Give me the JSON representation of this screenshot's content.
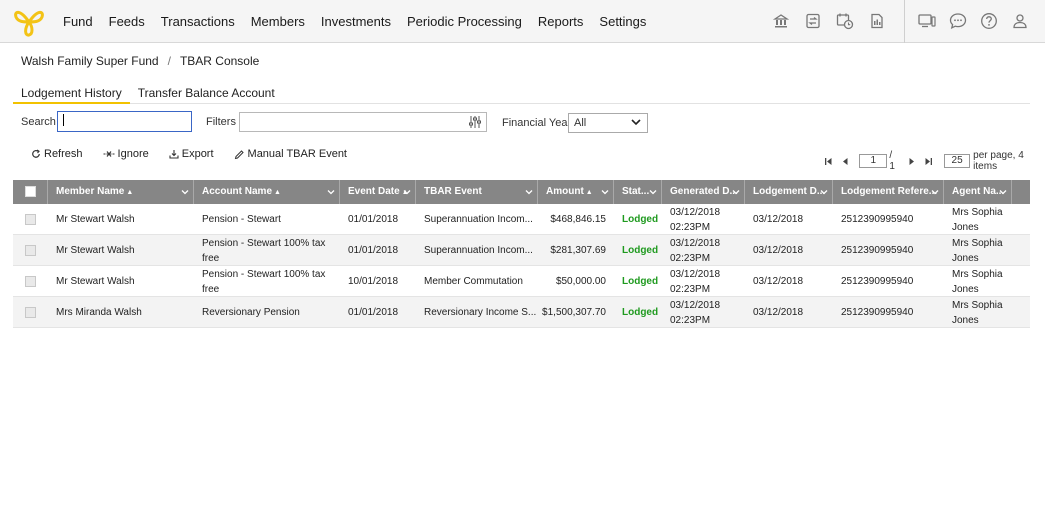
{
  "nav": {
    "items": [
      "Fund",
      "Feeds",
      "Transactions",
      "Members",
      "Investments",
      "Periodic Processing",
      "Reports",
      "Settings"
    ]
  },
  "toolbar_icons": [
    "bank-icon",
    "transfer-icon",
    "calendar-clock-icon",
    "document-icon"
  ],
  "user_icons": [
    "monitor-icon",
    "chat-icon",
    "help-icon",
    "user-icon"
  ],
  "breadcrumb": {
    "fund": "Walsh Family Super Fund",
    "sep": "/",
    "page": "TBAR Console"
  },
  "tabs": [
    {
      "label": "Lodgement History",
      "active": true
    },
    {
      "label": "Transfer Balance Account",
      "active": false
    }
  ],
  "filters": {
    "search_label": "Search",
    "search_value": "",
    "filters_label": "Filters",
    "fy_label": "Financial Year",
    "fy_value": "All"
  },
  "actions": {
    "refresh": "Refresh",
    "ignore": "Ignore",
    "export": "Export",
    "manual": "Manual TBAR Event"
  },
  "pager": {
    "page": "1",
    "total": "/ 1",
    "size": "25",
    "suffix": "per page, 4 items"
  },
  "grid": {
    "columns": [
      "Member Name",
      "Account Name",
      "Event Date",
      "TBAR Event",
      "Amount",
      "Stat...",
      "Generated D...",
      "Lodgement D...",
      "Lodgement Refere...",
      "Agent Na..."
    ],
    "sort_marks": [
      "▲",
      "▲",
      "▲",
      "",
      "▲",
      "",
      "",
      "",
      "",
      ""
    ],
    "rows": [
      {
        "member": "Mr Stewart Walsh",
        "account": "Pension - Stewart",
        "event_date": "01/01/2018",
        "event": "Superannuation Incom...",
        "amount": "$468,846.15",
        "status": "Lodged",
        "generated": "03/12/2018 02:23PM",
        "lodged": "03/12/2018",
        "ref": "2512390995940",
        "agent": "Mrs Sophia Jones"
      },
      {
        "member": "Mr Stewart Walsh",
        "account": "Pension - Stewart 100% tax free",
        "event_date": "01/01/2018",
        "event": "Superannuation Incom...",
        "amount": "$281,307.69",
        "status": "Lodged",
        "generated": "03/12/2018 02:23PM",
        "lodged": "03/12/2018",
        "ref": "2512390995940",
        "agent": "Mrs Sophia Jones"
      },
      {
        "member": "Mr Stewart Walsh",
        "account": "Pension - Stewart 100% tax free",
        "event_date": "10/01/2018",
        "event": "Member Commutation",
        "amount": "$50,000.00",
        "status": "Lodged",
        "generated": "03/12/2018 02:23PM",
        "lodged": "03/12/2018",
        "ref": "2512390995940",
        "agent": "Mrs Sophia Jones"
      },
      {
        "member": "Mrs Miranda Walsh",
        "account": "Reversionary Pension",
        "event_date": "01/01/2018",
        "event": "Reversionary Income S...",
        "amount": "$1,500,307.70",
        "status": "Lodged",
        "generated": "03/12/2018 02:23PM",
        "lodged": "03/12/2018",
        "ref": "2512390995940",
        "agent": "Mrs Sophia Jones"
      }
    ]
  }
}
